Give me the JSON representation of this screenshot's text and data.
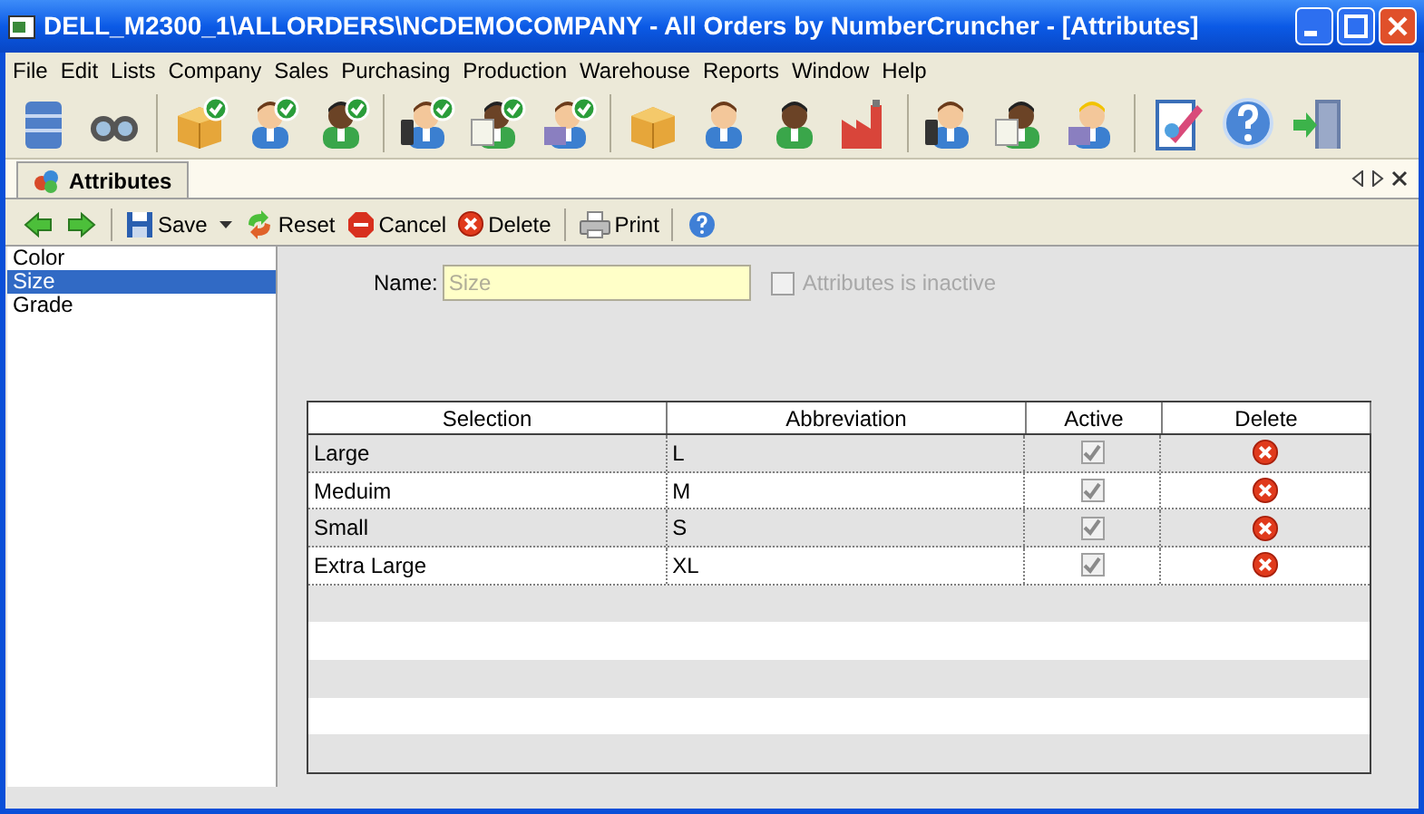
{
  "window": {
    "title": "DELL_M2300_1\\ALLORDERS\\NCDEMOCOMPANY - All Orders by NumberCruncher - [Attributes]"
  },
  "menu": [
    {
      "label": "File"
    },
    {
      "label": "Edit"
    },
    {
      "label": "Lists"
    },
    {
      "label": "Company"
    },
    {
      "label": "Sales"
    },
    {
      "label": "Purchasing"
    },
    {
      "label": "Production"
    },
    {
      "label": "Warehouse"
    },
    {
      "label": "Reports"
    },
    {
      "label": "Window"
    },
    {
      "label": "Help"
    }
  ],
  "tabs": [
    {
      "label": "Attributes",
      "selected": true
    }
  ],
  "toolbar": [
    {
      "kind": "back"
    },
    {
      "kind": "forward"
    },
    {
      "kind": "sep"
    },
    {
      "kind": "save",
      "label": "Save"
    },
    {
      "kind": "reset",
      "label": "Reset"
    },
    {
      "kind": "cancel",
      "label": "Cancel"
    },
    {
      "kind": "delete",
      "label": "Delete"
    },
    {
      "kind": "sep"
    },
    {
      "kind": "print",
      "label": "Print"
    },
    {
      "kind": "sep"
    },
    {
      "kind": "help"
    }
  ],
  "attribute_list": [
    {
      "label": "Color",
      "selected": false
    },
    {
      "label": "Size",
      "selected": true
    },
    {
      "label": "Grade",
      "selected": false
    }
  ],
  "name_field": {
    "label": "Name:",
    "value": "Size",
    "disabled": true
  },
  "inactive_checkbox": {
    "label": "Attributes is inactive",
    "checked": false,
    "disabled": true
  },
  "table": {
    "columns": [
      "Selection",
      "Abbreviation",
      "Active",
      "Delete"
    ],
    "rows": [
      {
        "selection": "Large",
        "abbreviation": "L",
        "active": true
      },
      {
        "selection": "Meduim",
        "abbreviation": "M",
        "active": true
      },
      {
        "selection": "Small",
        "abbreviation": "S",
        "active": true
      },
      {
        "selection": "Extra Large",
        "abbreviation": "XL",
        "active": true
      }
    ]
  }
}
